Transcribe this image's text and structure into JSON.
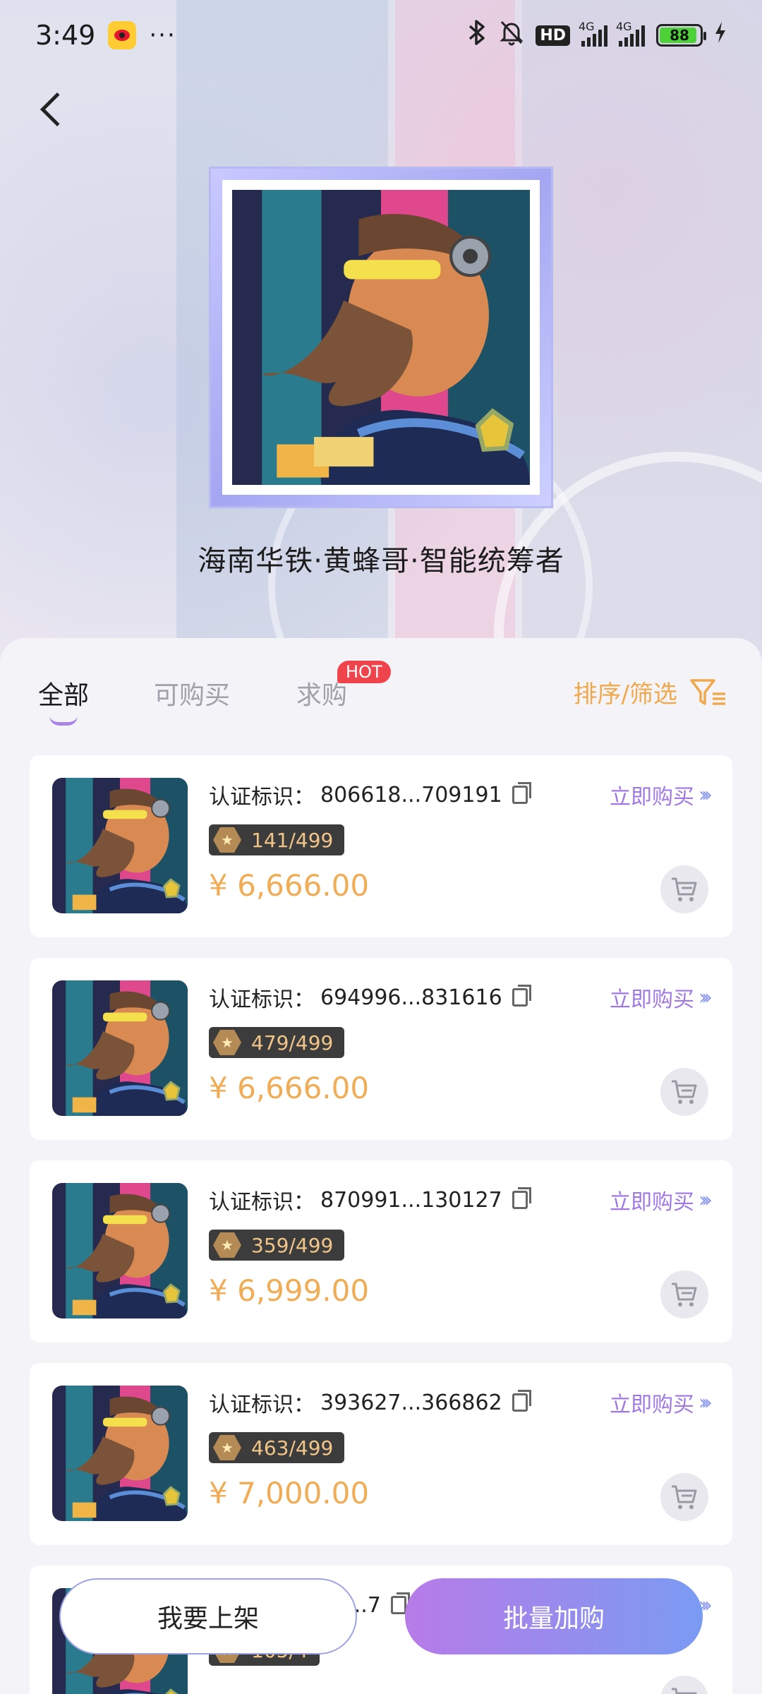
{
  "status_bar": {
    "time": "3:49",
    "more": "···",
    "network_1": "4G",
    "network_2": "4G",
    "hd_label": "HD",
    "battery": "88"
  },
  "artwork": {
    "title": "海南华铁·黄蜂哥·智能统筹者"
  },
  "tabs": [
    {
      "label": "全部",
      "active": true
    },
    {
      "label": "可购买",
      "active": false
    },
    {
      "label": "求购",
      "active": false,
      "badge": "HOT"
    }
  ],
  "sort_filter": {
    "label": "排序/筛选"
  },
  "listing_labels": {
    "cert_prefix": "认证标识：",
    "buy_now": "立即购买"
  },
  "listings": [
    {
      "cert_id": "806618...709191",
      "edition": "141/499",
      "price": "¥ 6,666.00"
    },
    {
      "cert_id": "694996...831616",
      "edition": "479/499",
      "price": "¥ 6,666.00"
    },
    {
      "cert_id": "870991...130127",
      "edition": "359/499",
      "price": "¥ 6,999.00"
    },
    {
      "cert_id": "393627...366862",
      "edition": "463/499",
      "price": "¥ 7,000.00"
    },
    {
      "cert_id": "25...7",
      "edition": "105/4",
      "price": ""
    }
  ],
  "bottom": {
    "list_button": "我要上架",
    "batch_button": "批量加购"
  },
  "colors": {
    "accent_orange": "#f1ad56",
    "accent_purple": "#a078e4",
    "hot_red": "#f0444d"
  }
}
